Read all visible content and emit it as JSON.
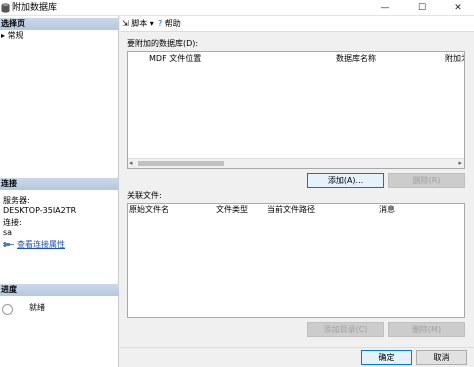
{
  "window": {
    "title": "附加数据库",
    "minimize_glyph": "—",
    "maximize_glyph": "☐",
    "close_glyph": "✕"
  },
  "left_panel": {
    "pages_header": "选择页",
    "pages": [
      {
        "label": "常规"
      }
    ],
    "connection_header": "连接",
    "server_label": "服务器:",
    "server_value": "DESKTOP-35IA2TR",
    "connection_label": "连接:",
    "connection_value": "sa",
    "view_connection_link": "查看连接属性",
    "progress_header": "进度",
    "progress_status": "就绪"
  },
  "toolbar": {
    "script_label": "脚本",
    "script_dropdown": "▾",
    "help_label": "帮助"
  },
  "databases_section": {
    "label": "要附加的数据库(D):",
    "columns": [
      "MDF 文件位置",
      "数据库名称",
      "附加为"
    ],
    "rows": [],
    "add_button": "添加(A)...",
    "remove_button": "删除(R)"
  },
  "files_section": {
    "label": "关联文件:",
    "columns": [
      "原始文件名",
      "文件类型",
      "当前文件路径",
      "消息"
    ],
    "rows": [],
    "add_catalog_button": "添加目录(C)",
    "remove_button": "删除(M)"
  },
  "footer": {
    "ok_button": "确定",
    "cancel_button": "取消"
  }
}
